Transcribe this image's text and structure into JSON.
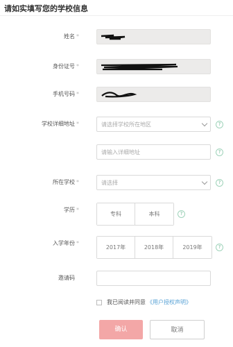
{
  "page": {
    "title": "请如实填写您的学校信息"
  },
  "form": {
    "name": {
      "label": "姓名",
      "required": "*"
    },
    "id_number": {
      "label": "身份证号",
      "required": "*"
    },
    "phone": {
      "label": "手机号码",
      "required": "*"
    },
    "school_address": {
      "label": "学校详细地址",
      "required": "*",
      "region_placeholder": "请选择学校所在地区",
      "detail_placeholder": "请输入详细地址"
    },
    "school": {
      "label": "所在学校",
      "required": "*",
      "placeholder": "请选择"
    },
    "education": {
      "label": "学历",
      "required": "*",
      "options": [
        "专科",
        "本科"
      ]
    },
    "enroll_year": {
      "label": "入学年份",
      "required": "*",
      "options": [
        "2017年",
        "2018年",
        "2019年"
      ]
    },
    "invite_code": {
      "label": "邀请码"
    },
    "help_glyph": "?"
  },
  "agreement": {
    "text": "我已阅读并同意",
    "link": "《用户授权声明》"
  },
  "buttons": {
    "confirm": "确认",
    "cancel": "取消"
  },
  "colors": {
    "confirm_bg": "#f3a7a7",
    "link": "#5aa3d6",
    "help": "#6fb995"
  }
}
